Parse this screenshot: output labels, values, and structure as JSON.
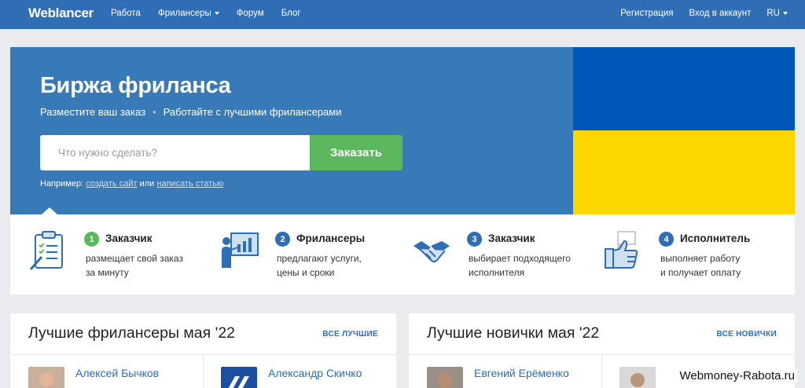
{
  "navbar": {
    "logo": "Weblancer",
    "links": [
      "Работа",
      "Фрилансеры",
      "Форум",
      "Блог"
    ],
    "register": "Регистрация",
    "login": "Вход в аккаунт",
    "language": "RU"
  },
  "hero": {
    "title": "Биржа фриланса",
    "sub_left": "Разместите ваш заказ",
    "sub_dot": "•",
    "sub_right": "Работайте с лучшими фрилансерами",
    "search_placeholder": "Что нужно сделать?",
    "order_button": "Заказать",
    "example_label": "Например:",
    "example_link1": "создать сайт",
    "example_or": "или",
    "example_link2": "написать статью"
  },
  "steps": [
    {
      "num": "1",
      "title": "Заказчик",
      "line1": "размещает свой заказ",
      "line2": "за минуту",
      "color": "#5cb85c",
      "icon": "clipboard-icon"
    },
    {
      "num": "2",
      "title": "Фрилансеры",
      "line1": "предлагают услуги,",
      "line2": "цены и сроки",
      "color": "#2f6db5",
      "icon": "presentation-icon"
    },
    {
      "num": "3",
      "title": "Заказчик",
      "line1": "выбирает подходящего",
      "line2": "исполнителя",
      "color": "#2f6db5",
      "icon": "handshake-icon"
    },
    {
      "num": "4",
      "title": "Исполнитель",
      "line1": "выполняет работу",
      "line2": "и получает оплату",
      "color": "#2f6db5",
      "icon": "thumbs-up-icon"
    }
  ],
  "best": {
    "title": "Лучшие фрилансеры мая '22",
    "link": "ВСЕ ЛУЧШИЕ",
    "people": [
      {
        "name": "Алексей Бычков"
      },
      {
        "name": "Александр Скичко"
      }
    ]
  },
  "newbies": {
    "title": "Лучшие новички мая '22",
    "link": "ВСЕ НОВИЧКИ",
    "people": [
      {
        "name": "Евгений Ерёменко"
      }
    ]
  },
  "watermark": "Webmoney-Rabota.ru",
  "colors": {
    "brand": "#2f6db5",
    "hero": "#3879b8",
    "green": "#5cb85c",
    "flag_blue": "#0057b8",
    "flag_yellow": "#ffd700"
  }
}
